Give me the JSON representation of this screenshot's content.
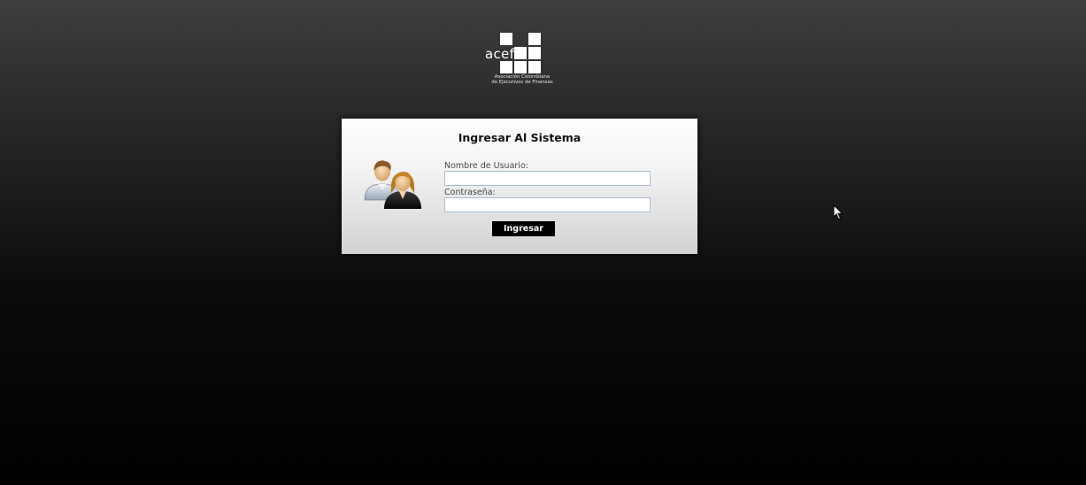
{
  "logo": {
    "word": "acef",
    "tagline_line1": "Asociación Colombiana",
    "tagline_line2": "de Ejecutivos de Finanzas"
  },
  "login": {
    "title": "Ingresar Al Sistema",
    "username_label": "Nombre de Usuario:",
    "username_value": "",
    "password_label": "Contraseña:",
    "password_value": "",
    "submit_label": "Ingresar",
    "icon": "users-icon"
  },
  "colors": {
    "page_top": "#3e3e3e",
    "page_bottom": "#000000",
    "panel_top": "#ffffff",
    "panel_bottom": "#d2d2d2",
    "button_bg": "#000000",
    "button_text": "#ffffff",
    "input_border": "#a9bdd3"
  }
}
